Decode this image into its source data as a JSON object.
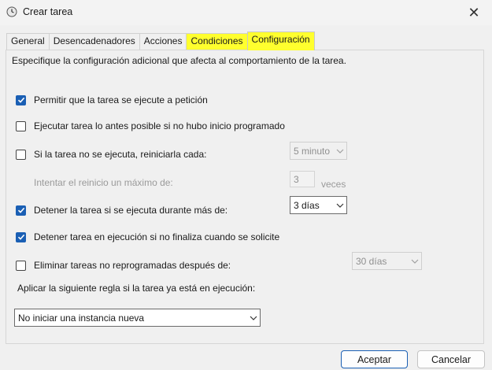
{
  "window": {
    "title": "Crear tarea",
    "close_label": "✕"
  },
  "tabs": [
    {
      "label": "General"
    },
    {
      "label": "Desencadenadores"
    },
    {
      "label": "Acciones"
    },
    {
      "label": "Condiciones"
    },
    {
      "label": "Configuración"
    }
  ],
  "settings": {
    "description": "Especifique la configuración adicional que afecta al comportamiento de la tarea.",
    "allow_on_demand": {
      "label": "Permitir que la tarea se ejecute a petición",
      "checked": true
    },
    "run_asap": {
      "label": "Ejecutar tarea lo antes posible si no hubo inicio programado",
      "checked": false
    },
    "restart_on_fail": {
      "label": "Si la tarea no se ejecuta, reiniciarla cada:",
      "checked": false,
      "interval": "5 minuto"
    },
    "restart_attempts": {
      "label": "Intentar el reinicio un máximo de:",
      "value": "3",
      "unit": "veces"
    },
    "stop_if_longer": {
      "label": "Detener la tarea si se ejecuta durante más de:",
      "checked": true,
      "value": "3 días"
    },
    "force_stop": {
      "label": "Detener tarea en ejecución si no finaliza cuando se solicite",
      "checked": true
    },
    "delete_if_not_scheduled": {
      "label": "Eliminar tareas no reprogramadas después de:",
      "checked": false,
      "value": "30 días"
    },
    "running_rule_label": "Aplicar la siguiente regla si la tarea ya está en ejecución:",
    "running_rule_value": "No iniciar una instancia nueva"
  },
  "buttons": {
    "ok": "Aceptar",
    "cancel": "Cancelar"
  },
  "colors": {
    "highlight": "#ffff2e",
    "checkbox_checked": "#1a5fb4"
  }
}
